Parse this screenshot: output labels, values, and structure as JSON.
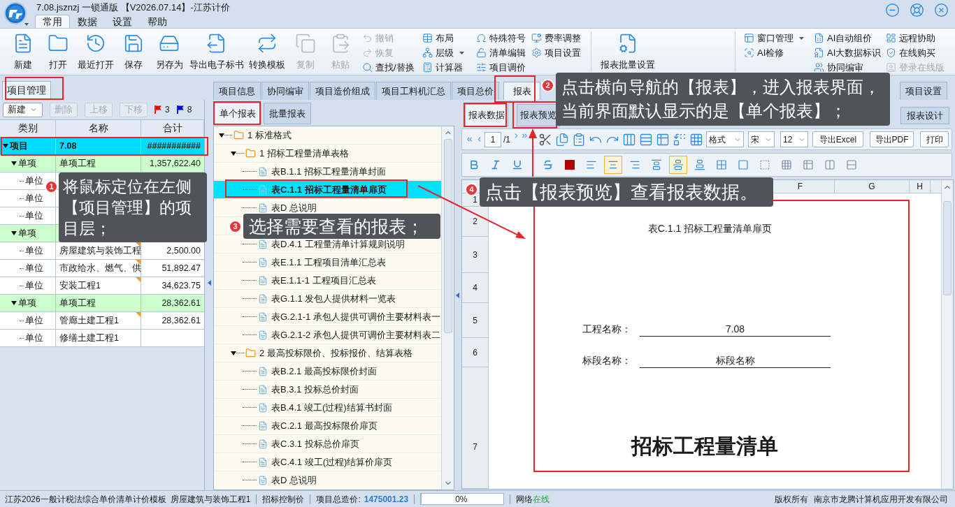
{
  "window": {
    "title": "7.08.jsznzj 一锁通版 【V2026.07.14】-江苏计价"
  },
  "menu_tabs": [
    {
      "label": "常用",
      "selected": true
    },
    {
      "label": "数据",
      "selected": false
    },
    {
      "label": "设置",
      "selected": false
    },
    {
      "label": "帮助",
      "selected": false
    }
  ],
  "ribbon": {
    "large_buttons": [
      {
        "label": "新建",
        "disabled": false
      },
      {
        "label": "打开",
        "disabled": false
      },
      {
        "label": "最近打开",
        "disabled": false
      },
      {
        "label": "保存",
        "disabled": false
      },
      {
        "label": "另存为",
        "disabled": false
      },
      {
        "label": "导出电子标书",
        "disabled": false
      },
      {
        "label": "转换模板",
        "disabled": false
      },
      {
        "label": "复制",
        "disabled": true
      },
      {
        "label": "粘贴",
        "disabled": true
      }
    ],
    "small_groups": [
      [
        {
          "label": "撤销",
          "disabled": true,
          "dropdown": false
        },
        {
          "label": "恢复",
          "disabled": true,
          "dropdown": false
        },
        {
          "label": "查找/替换",
          "disabled": false,
          "dropdown": false
        }
      ],
      [
        {
          "label": "布局",
          "disabled": false,
          "dropdown": false
        },
        {
          "label": "层级",
          "disabled": false,
          "dropdown": true
        },
        {
          "label": "计算器",
          "disabled": false,
          "dropdown": false
        }
      ],
      [
        {
          "label": "特殊符号",
          "disabled": false,
          "dropdown": false
        },
        {
          "label": "清单编辑",
          "disabled": false,
          "dropdown": false
        },
        {
          "label": "项目调价",
          "disabled": false,
          "dropdown": false
        }
      ],
      [
        {
          "label": "费率调整",
          "disabled": false,
          "dropdown": false
        },
        {
          "label": "项目设置",
          "disabled": false,
          "dropdown": false
        }
      ]
    ],
    "report_button": {
      "label": "报表批量设置"
    },
    "right_groups": [
      [
        {
          "label": "窗口管理",
          "disabled": false,
          "dropdown": true
        },
        {
          "label": "AI检修",
          "disabled": false,
          "dropdown": false
        }
      ],
      [
        {
          "label": "AI自动组价",
          "disabled": false,
          "dropdown": false
        },
        {
          "label": "AI大数据标识",
          "disabled": false,
          "dropdown": false
        },
        {
          "label": "协同编审",
          "disabled": false,
          "dropdown": false
        }
      ],
      [
        {
          "label": "远程协助",
          "disabled": false,
          "dropdown": false
        },
        {
          "label": "在线购买",
          "disabled": false,
          "dropdown": false
        },
        {
          "label": "登录在线版",
          "disabled": true,
          "dropdown": false
        }
      ]
    ]
  },
  "project_panel": {
    "tab": {
      "label": "项目管理",
      "selected": true
    },
    "toolbar": [
      {
        "label": "新建",
        "disabled": false,
        "dropdown": true
      },
      {
        "label": "删除",
        "disabled": true,
        "dropdown": false
      },
      {
        "label": "上移",
        "disabled": true,
        "dropdown": false
      },
      {
        "label": "下移",
        "disabled": true,
        "dropdown": false
      }
    ],
    "flags": [
      {
        "count": "3",
        "color": "#ff0000"
      },
      {
        "count": "8",
        "color": "#0000ff"
      }
    ],
    "columns": [
      "类别",
      "名称",
      "合计"
    ],
    "rows": [
      {
        "category": "项目",
        "name": "7.08",
        "total": "###########",
        "selected": true,
        "expanded": true,
        "marked": false,
        "children": [
          {
            "category": "单项",
            "name": "单项工程",
            "total": "1,357,622.40",
            "selected": false,
            "expanded": true,
            "marked": false,
            "children": [
              {
                "category": "单位",
                "selected": false
              },
              {
                "category": "单位",
                "selected": false
              },
              {
                "category": "单位",
                "selected": false
              }
            ]
          },
          {
            "category": "单项",
            "selected": false,
            "expanded": true,
            "children": [
              {
                "category": "单位",
                "name": "房屋建筑与装饰工程",
                "total": "2,500.00",
                "selected": false,
                "marked": true
              },
              {
                "category": "单位",
                "name": "市政给水、燃气、供",
                "total": "51,892.47",
                "selected": false,
                "marked": true
              },
              {
                "category": "单位",
                "name": "安装工程1",
                "total": "34,623.75",
                "selected": false,
                "marked": true
              }
            ]
          },
          {
            "category": "单项",
            "name": "单项工程",
            "total": "28,362.61",
            "selected": false,
            "expanded": true,
            "marked": false,
            "children": [
              {
                "category": "单位",
                "name": "管廊土建工程1",
                "total": "28,362.61",
                "selected": false,
                "marked": true
              },
              {
                "category": "单位",
                "name": "修缮土建工程1",
                "selected": false,
                "marked": false
              }
            ]
          }
        ]
      }
    ]
  },
  "main_tabs": [
    {
      "label": "项目信息",
      "selected": false
    },
    {
      "label": "协同编审",
      "selected": false
    },
    {
      "label": "项目造价组成",
      "selected": false
    },
    {
      "label": "项目工料机汇总",
      "selected": false
    },
    {
      "label": "项目总价",
      "selected": false
    },
    {
      "label": "报表",
      "selected": true
    },
    {
      "label": "项目设置",
      "selected": false
    }
  ],
  "report_panel": {
    "tabs": [
      {
        "label": "单个报表",
        "selected": true
      },
      {
        "label": "批量报表",
        "selected": false
      }
    ],
    "tree": [
      {
        "kind": "folder",
        "label": "1 标准格式",
        "expanded": true,
        "selected": false,
        "children": [
          {
            "kind": "folder",
            "label": "1 招标工程量清单表格",
            "expanded": true,
            "selected": false,
            "children": [
              {
                "kind": "report",
                "label": "表B.1.1 招标工程量清单封面",
                "selected": false
              },
              {
                "kind": "report",
                "label": "表C.1.1 招标工程量清单扉页",
                "selected": true
              },
              {
                "kind": "report",
                "label": "表D 总说明",
                "selected": false
              },
              {
                "kind": "report",
                "selected": false
              },
              {
                "kind": "report",
                "label": "表D.4.1 工程量清单计算规则说明",
                "selected": false
              },
              {
                "kind": "report",
                "label": "表E.1.1 工程项目清单汇总表",
                "selected": false
              },
              {
                "kind": "report",
                "label": "表E.1.1-1 工程项目汇总表",
                "selected": false
              },
              {
                "kind": "report",
                "label": "表G.1.1 发包人提供材料一览表",
                "selected": false
              },
              {
                "kind": "report",
                "label": "表G.2.1-1 承包人提供可调价主要材料表一",
                "selected": false
              },
              {
                "kind": "report",
                "label": "表G.2.1-2 承包人提供可调价主要材料表二",
                "selected": false
              }
            ]
          },
          {
            "kind": "folder",
            "label": "2 最高投标限价、投标报价、结算表格",
            "expanded": true,
            "selected": false,
            "children": [
              {
                "kind": "report",
                "label": "表B.2.1 最高投标限价封面",
                "selected": false
              },
              {
                "kind": "report",
                "label": "表B.3.1 投标总价封面",
                "selected": false
              },
              {
                "kind": "report",
                "label": "表B.4.1 竣工(过程)结算书封面",
                "selected": false
              },
              {
                "kind": "report",
                "label": "表C.2.1 最高投标限价扉页",
                "selected": false
              },
              {
                "kind": "report",
                "label": "表C.3.1 投标总价扉页",
                "selected": false
              },
              {
                "kind": "report",
                "label": "表C.4.1 竣工(过程)结算价扉页",
                "selected": false
              },
              {
                "kind": "report",
                "label": "表D 总说明",
                "selected": false
              }
            ]
          }
        ]
      }
    ]
  },
  "preview_panel": {
    "tabs": [
      {
        "label": "报表数据",
        "selected": true
      },
      {
        "label": "报表预览",
        "selected": false
      }
    ],
    "design_button": "报表设计",
    "pager": {
      "page": "1",
      "total": "/1"
    },
    "selects": [
      "格式",
      "宋",
      "12"
    ],
    "buttons": [
      "导出Excel",
      "导出PDF",
      "打印"
    ],
    "format_buttons": [
      {
        "selected": false
      },
      {
        "selected": false
      },
      {
        "selected": false
      },
      {
        "selected": false
      },
      {
        "selected": false
      },
      {
        "selected": false
      },
      {
        "selected": true
      },
      {
        "selected": false
      },
      {
        "selected": false
      },
      {
        "selected": true
      },
      {
        "selected": false
      },
      {
        "selected": false
      },
      {
        "selected": false
      },
      {
        "selected": false
      },
      {
        "selected": false
      },
      {
        "selected": false
      },
      {
        "selected": false
      },
      {
        "selected": false
      }
    ],
    "column_headers": [
      "F",
      "G",
      "H"
    ],
    "row_headers": [
      "1",
      "2",
      "3",
      "4",
      "5",
      "6",
      "7"
    ],
    "document": {
      "title": "表C.1.1 招标工程量清单扉页",
      "fields": [
        {
          "label": "工程名称：",
          "value": "7.08"
        },
        {
          "label": "标段名称：",
          "value": "标段名称"
        }
      ],
      "heading": "招标工程量清单"
    }
  },
  "status_bar": {
    "template": "江苏2026一般计税法综合单价清单计价模板",
    "unit": "房屋建筑与装饰工程1",
    "mode": "招标控制价",
    "total_label": "项目总造价:",
    "total": "1475001.23",
    "progress": {
      "level": 0,
      "reading": "0%"
    },
    "network": {
      "label": "网络",
      "status": "在线",
      "online": true
    },
    "copyright": "版权所有",
    "company": "南京市龙腾计算机应用开发有限公司"
  },
  "annotations": [
    {
      "number": "1",
      "text": "将鼠标定位在左侧【项目管理】的项目层；"
    },
    {
      "number": "2",
      "text": "点击横向导航的【报表】，进入报表界面，当前界面默认显示的是【单个报表】；"
    },
    {
      "number": "3",
      "text": "选择需要查看的报表；"
    },
    {
      "number": "4",
      "text": "点击【报表预览】查看报表数据。"
    }
  ]
}
